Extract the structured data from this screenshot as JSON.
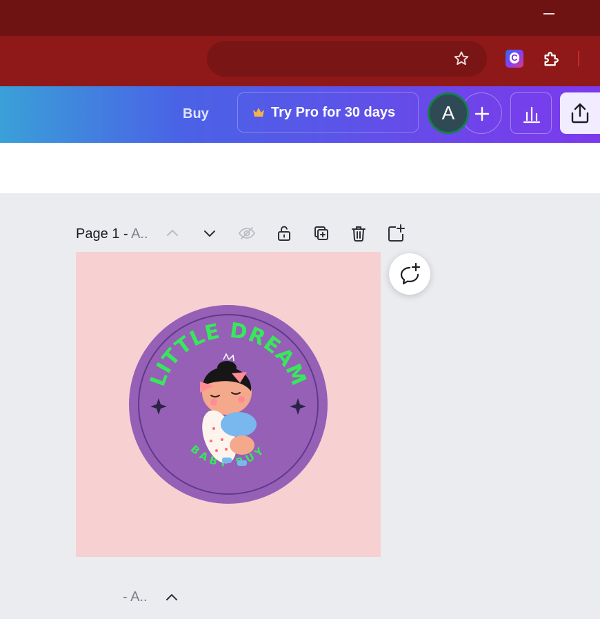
{
  "browser": {
    "extensions": [
      "canva-extension-icon",
      "puzzle-icon"
    ],
    "canva_ext_glyph": "C"
  },
  "header": {
    "buy_label": "Buy",
    "try_pro_label": "Try Pro for 30 days",
    "avatar_initial": "A",
    "colors": {
      "gradient_start": "#3aa0d8",
      "gradient_end": "#7c3aed",
      "avatar_ring": "#12804a"
    }
  },
  "page_toolbar": {
    "page_label": "Page 1 - ",
    "page_name": "A..",
    "icons": [
      "chevron-up-icon",
      "chevron-down-icon",
      "eye-hidden-icon",
      "lock-icon",
      "duplicate-icon",
      "trash-icon",
      "add-page-icon"
    ]
  },
  "design": {
    "badge_top_text": "LITTLE DREAM",
    "badge_bottom_text": "BABY BUY",
    "colors": {
      "background": "#f7d0d2",
      "badge": "#9560b6",
      "text": "#37e85b"
    }
  },
  "page2": {
    "title_suffix": "- A.."
  }
}
